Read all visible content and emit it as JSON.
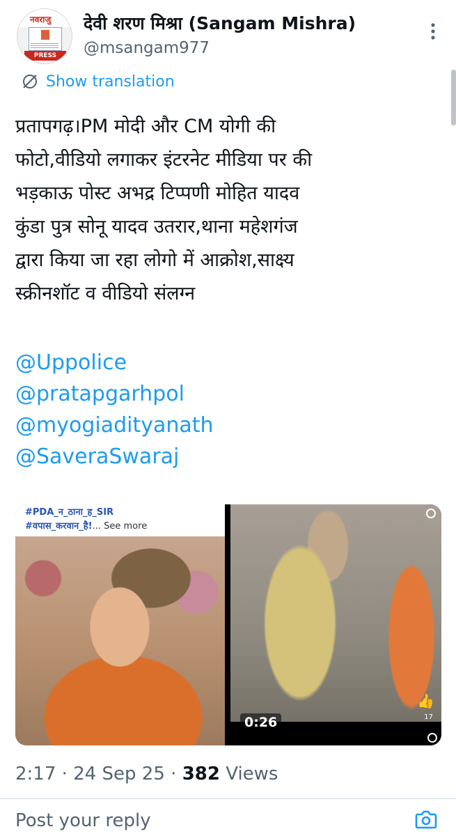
{
  "author": {
    "display_name": "देवी शरण मिश्रा (Sangam Mishra)",
    "handle": "@msangam977",
    "avatar": {
      "banner_text": "नवराजु",
      "press_text": "PRESS"
    }
  },
  "translate_label": "Show translation",
  "tweet": {
    "lines": [
      "प्रतापगढ़।PM मोदी और CM योगी की",
      "फोटो,वीडियो लगाकर इंटरनेट मीडिया पर की",
      "भड़काऊ पोस्ट अभद्र टिप्पणी मोहित यादव",
      "कुंडा पुत्र सोनू यादव उतरार,थाना महेशगंज",
      "द्वारा किया जा रहा लोगो में आक्रोश,साक्ष्य",
      "स्क्रीनशॉट व वीडियो संलग्न"
    ],
    "mentions": [
      "@Uppolice",
      "@pratapgarhpol",
      "@myogiadityanath",
      "@SaveraSwaraj"
    ]
  },
  "media": {
    "left": {
      "caption_line1": "#PDA_न_ठाना_ह_SIR",
      "caption_line2_tag": "#वपास_करवान_है!",
      "caption_line2_more": "... See more"
    },
    "right": {
      "duration": "0:26",
      "like_count": "17"
    }
  },
  "meta": {
    "time": "2:17",
    "date": "24 Sep 25",
    "separator": " · ",
    "views_count": "382",
    "views_label": " Views"
  },
  "reply": {
    "placeholder": "Post your reply"
  },
  "colors": {
    "accent": "#1d9bf0",
    "text": "#0f1419",
    "secondary": "#536471",
    "divider": "#cfd9de"
  },
  "icons": {
    "more": "more-vertical-icon",
    "translate": "globe-slash-icon",
    "camera": "camera-icon",
    "like": "thumbs-up-icon"
  }
}
